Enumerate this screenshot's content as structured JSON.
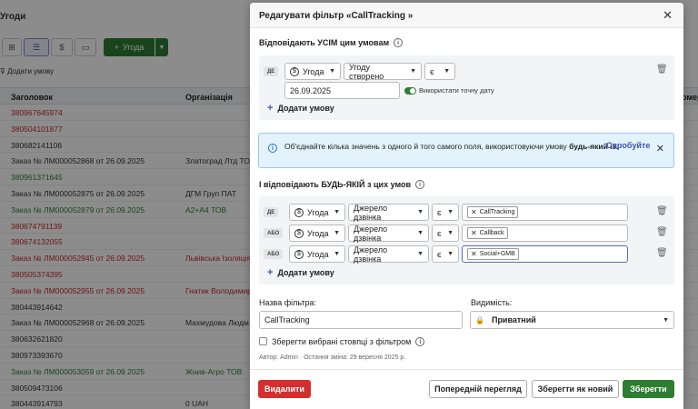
{
  "background": {
    "title": "Угоди",
    "add_deal_label": "Угода",
    "add_condition_label": "Додати умову",
    "columns": [
      "Заголовок",
      "Організація",
      "омер"
    ],
    "rows": [
      {
        "title": "380967645974",
        "org": "",
        "color": "red"
      },
      {
        "title": "380504101877",
        "org": "",
        "color": "red"
      },
      {
        "title": "380682141106",
        "org": "",
        "color": "dark"
      },
      {
        "title": "Заказ № ЛМ000052868 от 26.09.2025",
        "org": "Златоград Лтд ТОВ",
        "color": "dark"
      },
      {
        "title": "380961371645",
        "org": "",
        "color": "green"
      },
      {
        "title": "Заказ № ЛМ000052875 от 26.09.2025",
        "org": "ДГМ Груп ПАТ",
        "color": "dark"
      },
      {
        "title": "Заказ № ЛМ000052879 от 26.09.2025",
        "org": "А2+А4 ТОВ",
        "color": "green"
      },
      {
        "title": "380674791139",
        "org": "",
        "color": "red"
      },
      {
        "title": "380674132055",
        "org": "",
        "color": "red"
      },
      {
        "title": "Заказ № ЛМ000052945 от 26.09.2025",
        "org": "Львівська Ізоляція",
        "color": "red"
      },
      {
        "title": "380505374395",
        "org": "",
        "color": "red"
      },
      {
        "title": "Заказ № ЛМ000052955 от 26.09.2025",
        "org": "Гнатик Володимир",
        "color": "red"
      },
      {
        "title": "380443914642",
        "org": "",
        "color": "dark"
      },
      {
        "title": "Заказ № ЛМ000052968 от 26.09.2025",
        "org": "Махмудова Людм",
        "color": "dark"
      },
      {
        "title": "380632621820",
        "org": "",
        "color": "dark"
      },
      {
        "title": "380973393670",
        "org": "",
        "color": "dark"
      },
      {
        "title": "Заказ № ЛМ000053059 от 26.09.2025",
        "org": "Жнив-Агро ТОВ",
        "color": "green"
      },
      {
        "title": "380509473106",
        "org": "",
        "color": "dark"
      },
      {
        "title": "380443914793",
        "org": "0 UAH",
        "color": "dark"
      }
    ]
  },
  "modal": {
    "title": "Редагувати фільтр «CallTracking »",
    "all_section_label": "Відповідають УСІМ цим умовам",
    "all_conditions": [
      {
        "tag": "ДЕ",
        "entity": "Угода",
        "field": "Угоду створено",
        "operator": "є",
        "value": "26.09.2025",
        "toggle_label": "Використати точну дату"
      }
    ],
    "add_condition_label": "Додати умову",
    "alert": {
      "text_prefix": "Об'єднайте кілька значень з одного й того самого поля, використовуючи умову",
      "text_bold": "будь-який із.",
      "link": "Спробуйте"
    },
    "any_section_label": "І відповідають БУДЬ-ЯКІЙ з цих умов",
    "any_conditions": [
      {
        "tag": "ДЕ",
        "entity": "Угода",
        "field": "Джерело дзвінка",
        "operator": "є",
        "chips": [
          "CallTracking"
        ]
      },
      {
        "tag": "АБО",
        "entity": "Угода",
        "field": "Джерело дзвінка",
        "operator": "є",
        "chips": [
          "Callback"
        ]
      },
      {
        "tag": "АБО",
        "entity": "Угода",
        "field": "Джерело дзвінка",
        "operator": "є",
        "chips": [
          "Social+GMB"
        ]
      }
    ],
    "add_condition_label_2": "Додати умову",
    "filter_name_label": "Назва фільтра:",
    "filter_name_value": "CallTracking",
    "visibility_label": "Видимість:",
    "visibility_value": "Приватний",
    "save_columns_label": "Зберегти вибрані стовпці з фільтром",
    "meta": "Автор: Admin · Остання зміна: 29 вересня 2025 р.",
    "buttons": {
      "delete": "Видалити",
      "preview": "Попередній перегляд",
      "save_new": "Зберегти як новий",
      "save": "Зберегти"
    }
  },
  "colors": {
    "primary_green": "#2e7d32",
    "danger_red": "#d32f2f",
    "link_blue": "#3f51b5",
    "alert_bg": "#e4f2fc"
  }
}
